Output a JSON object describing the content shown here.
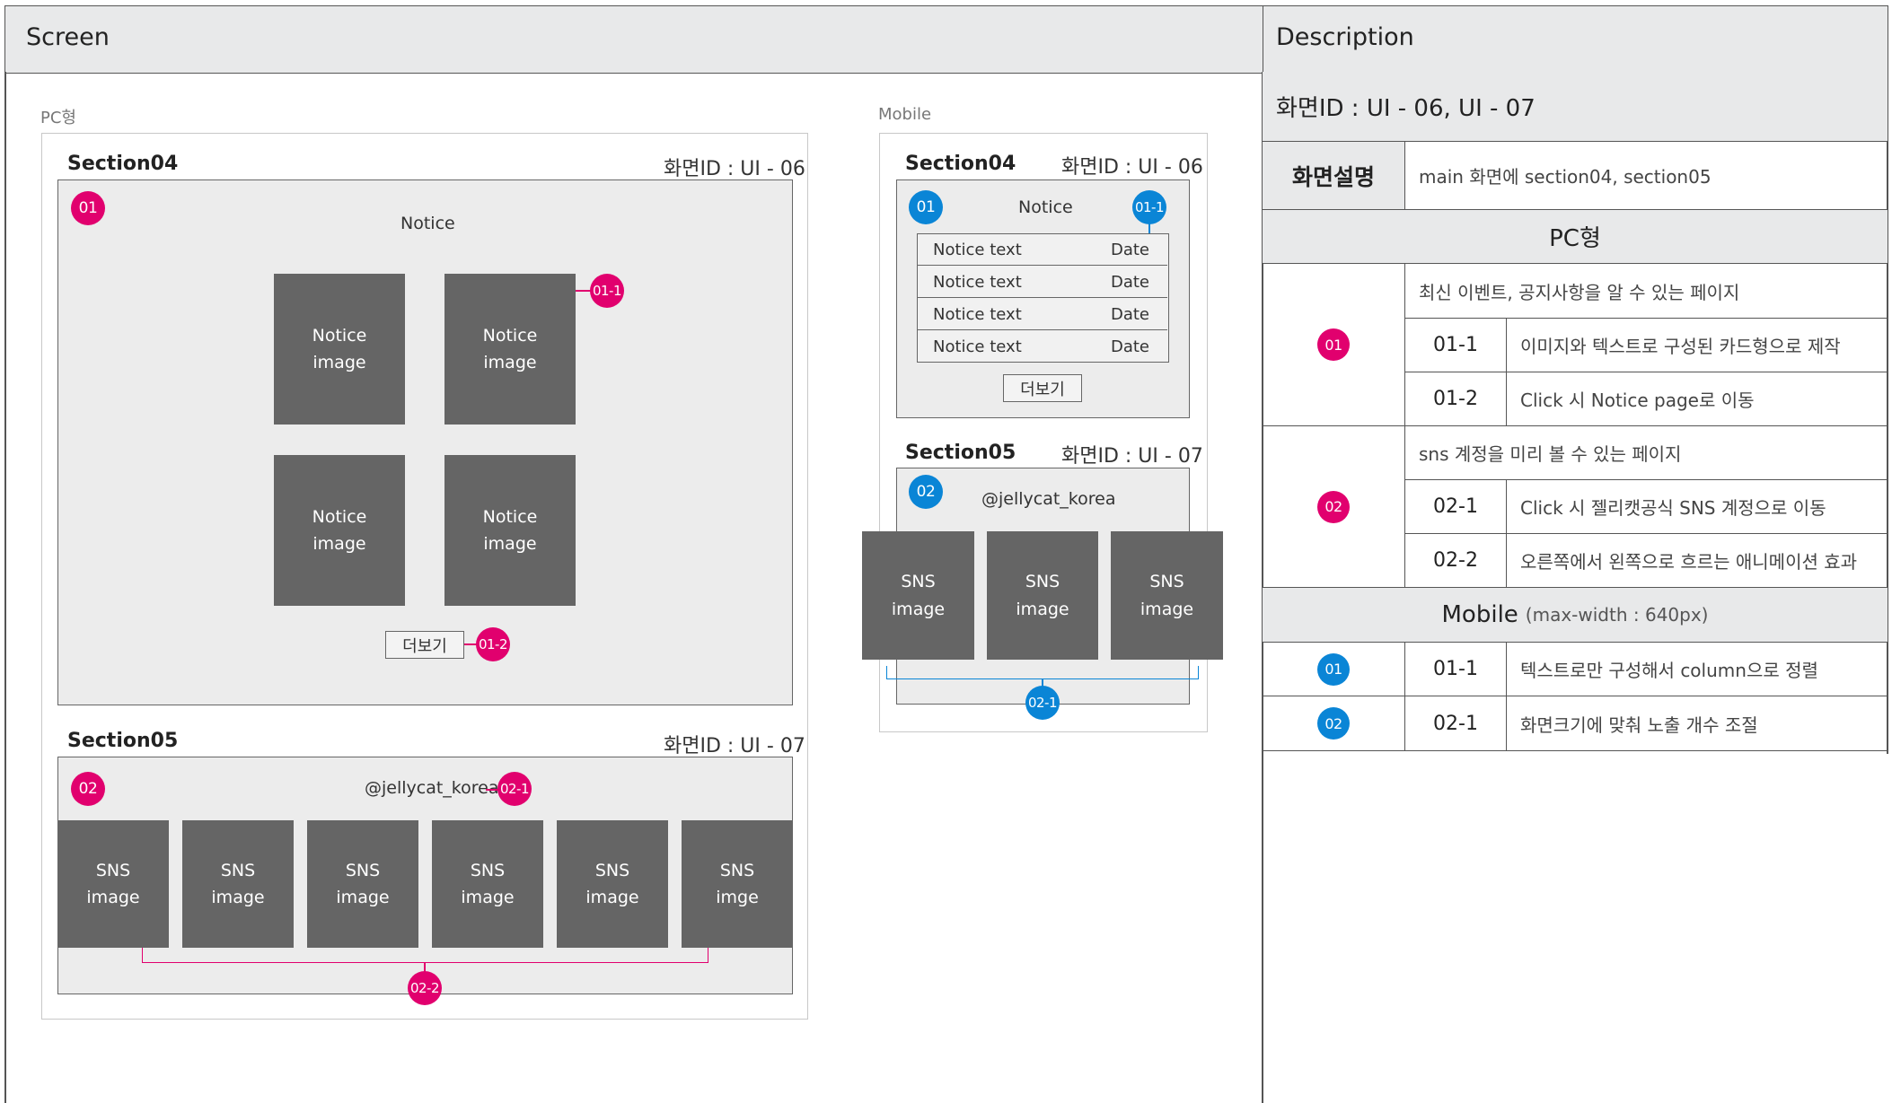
{
  "headers": {
    "screen": "Screen",
    "description": "Description"
  },
  "pc": {
    "label": "PC형",
    "section04": {
      "title": "Section04",
      "screen_id": "화면ID :  UI - 06",
      "notice_title": "Notice",
      "cards": [
        {
          "line1": "Notice",
          "line2": "image"
        },
        {
          "line1": "Notice",
          "line2": "image"
        },
        {
          "line1": "Notice",
          "line2": "image"
        },
        {
          "line1": "Notice",
          "line2": "image"
        }
      ],
      "more_button": "더보기",
      "markers": {
        "m01": "01",
        "m01_1": "01-1",
        "m01_2": "01-2"
      }
    },
    "section05": {
      "title": "Section05",
      "screen_id": "화면ID :  UI - 07",
      "account": "@jellycat_korea",
      "images": [
        {
          "line1": "SNS",
          "line2": "image"
        },
        {
          "line1": "SNS",
          "line2": "image"
        },
        {
          "line1": "SNS",
          "line2": "image"
        },
        {
          "line1": "SNS",
          "line2": "image"
        },
        {
          "line1": "SNS",
          "line2": "image"
        },
        {
          "line1": "SNS",
          "line2": "imge"
        }
      ],
      "markers": {
        "m02": "02",
        "m02_1": "02-1",
        "m02_2": "02-2"
      }
    }
  },
  "mobile": {
    "label": "Mobile",
    "section04": {
      "title": "Section04",
      "screen_id": "화면ID :  UI - 06",
      "notice_title": "Notice",
      "rows": [
        {
          "text": "Notice text",
          "date": "Date"
        },
        {
          "text": "Notice text",
          "date": "Date"
        },
        {
          "text": "Notice text",
          "date": "Date"
        },
        {
          "text": "Notice text",
          "date": "Date"
        }
      ],
      "more_button": "더보기",
      "markers": {
        "m01": "01",
        "m01_1": "01-1"
      }
    },
    "section05": {
      "title": "Section05",
      "screen_id": "화면ID :  UI - 07",
      "account": "@jellycat_korea",
      "images": [
        {
          "line1": "SNS",
          "line2": "image"
        },
        {
          "line1": "SNS",
          "line2": "image"
        },
        {
          "line1": "SNS",
          "line2": "image"
        }
      ],
      "markers": {
        "m02": "02",
        "m02_1": "02-1"
      }
    }
  },
  "description": {
    "screen_id_title": "화면ID : UI - 06, UI - 07",
    "screen_desc_label": "화면설명",
    "screen_desc_value": "main 화면에 section04, section05",
    "pc_heading": "PC형",
    "pc_groups": [
      {
        "badge": "01",
        "summary": "최신 이벤트, 공지사항을 알 수 있는 페이지",
        "items": [
          {
            "id": "01-1",
            "text": "이미지와 텍스트로 구성된 카드형으로 제작"
          },
          {
            "id": "01-2",
            "text": "Click 시 Notice page로 이동"
          }
        ]
      },
      {
        "badge": "02",
        "summary": "sns 계정을 미리 볼 수 있는 페이지",
        "items": [
          {
            "id": "02-1",
            "text": "Click 시 젤리캣공식 SNS 계정으로 이동"
          },
          {
            "id": "02-2",
            "text": "오른쪽에서 왼쪽으로 흐르는 애니메이션 효과"
          }
        ]
      }
    ],
    "mobile_heading": "Mobile",
    "mobile_heading_note": "(max-width : 640px)",
    "mobile_rows": [
      {
        "badge": "01",
        "id": "01-1",
        "text": "텍스트로만 구성해서 column으로 정렬"
      },
      {
        "badge": "02",
        "id": "02-1",
        "text": "화면크기에 맞춰 노출 개수 조절"
      }
    ]
  },
  "colors": {
    "pink": "#e1006e",
    "blue": "#0a85d6",
    "placeholder": "#656565",
    "panel": "#ececec",
    "header": "#e8e9ea"
  }
}
